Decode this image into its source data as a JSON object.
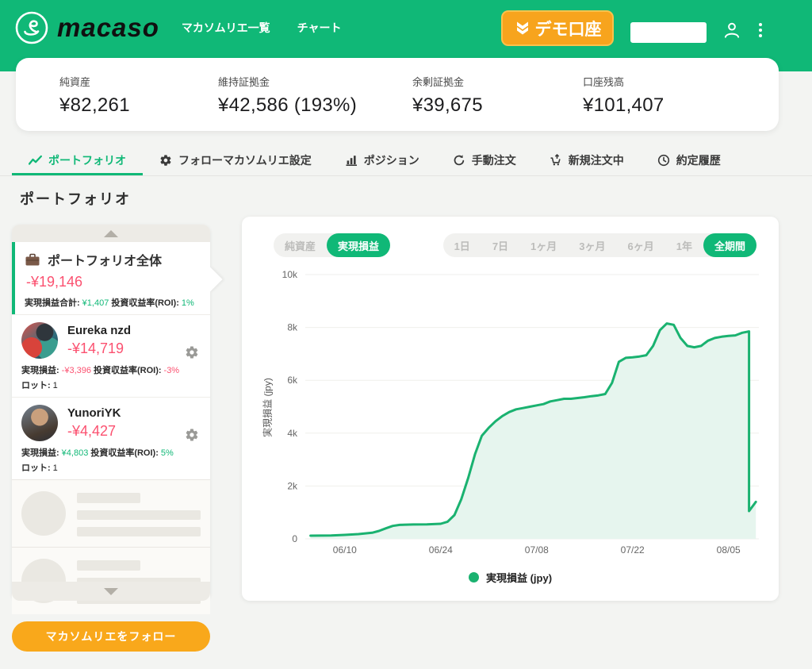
{
  "header": {
    "brand": "macaso",
    "nav": [
      {
        "label": "マカソムリエ一覧"
      },
      {
        "label": "チャート"
      }
    ],
    "demo_badge": "デモ口座"
  },
  "account_stats": [
    {
      "label": "純資産",
      "value": "¥82,261"
    },
    {
      "label": "維持証拠金",
      "value": "¥42,586 (193%)"
    },
    {
      "label": "余剰証拠金",
      "value": "¥39,675"
    },
    {
      "label": "口座残高",
      "value": "¥101,407"
    }
  ],
  "tabs": [
    {
      "label": "ポートフォリオ",
      "icon": "line-chart-icon",
      "active": true
    },
    {
      "label": "フォローマカソムリエ設定",
      "icon": "gear-icon",
      "active": false
    },
    {
      "label": "ポジション",
      "icon": "bar-chart-icon",
      "active": false
    },
    {
      "label": "手動注文",
      "icon": "refresh-icon",
      "active": false
    },
    {
      "label": "新規注文中",
      "icon": "cart-icon",
      "active": false
    },
    {
      "label": "約定履歴",
      "icon": "clock-icon",
      "active": false
    }
  ],
  "page_title": "ポートフォリオ",
  "portfolio_panel": {
    "summary": {
      "title": "ポートフォリオ全体",
      "total": "-¥19,146",
      "stat1_label": "実現損益合計:",
      "stat1_value": "¥1,407",
      "stat2_label": "投資収益率(ROI):",
      "stat2_value": "1%"
    },
    "items": [
      {
        "name": "Eureka nzd",
        "total": "-¥14,719",
        "stat1_label": "実現損益:",
        "stat1_value": "-¥3,396",
        "stat2_label": "投資収益率(ROI):",
        "stat2_value": "-3%",
        "stat3_label": "ロット:",
        "stat3_value": "1"
      },
      {
        "name": "YunoriYK",
        "total": "-¥4,427",
        "stat1_label": "実現損益:",
        "stat1_value": "¥4,803",
        "stat2_label": "投資収益率(ROI):",
        "stat2_value": "5%",
        "stat3_label": "ロット:",
        "stat3_value": "1"
      }
    ],
    "follow_button": "マカソムリエをフォロー"
  },
  "chart_card": {
    "metric_toggle": [
      {
        "label": "純資産",
        "active": false
      },
      {
        "label": "実現損益",
        "active": true
      }
    ],
    "range_toggle": [
      {
        "label": "1日",
        "active": false
      },
      {
        "label": "7日",
        "active": false
      },
      {
        "label": "1ヶ月",
        "active": false
      },
      {
        "label": "3ヶ月",
        "active": false
      },
      {
        "label": "6ヶ月",
        "active": false
      },
      {
        "label": "1年",
        "active": false
      },
      {
        "label": "全期間",
        "active": true
      }
    ]
  },
  "chart_data": {
    "type": "area",
    "title": "",
    "ylabel": "実現損益 (jpy)",
    "legend": "実現損益 (jpy)",
    "ylim": [
      0,
      10000
    ],
    "yticks": [
      "0",
      "2k",
      "4k",
      "6k",
      "8k",
      "10k"
    ],
    "xticks": [
      "06/10",
      "06/24",
      "07/08",
      "07/22",
      "08/05"
    ],
    "grid": true,
    "legend_position": "bottom",
    "line_color": "#1ab270",
    "fill_color": "#e6f5ee",
    "points": [
      [
        "06/05",
        120
      ],
      [
        "06/08",
        130
      ],
      [
        "06/10",
        150
      ],
      [
        "06/12",
        180
      ],
      [
        "06/14",
        230
      ],
      [
        "06/15",
        300
      ],
      [
        "06/16",
        400
      ],
      [
        "06/17",
        490
      ],
      [
        "06/18",
        530
      ],
      [
        "06/20",
        545
      ],
      [
        "06/22",
        550
      ],
      [
        "06/24",
        570
      ],
      [
        "06/25",
        650
      ],
      [
        "06/26",
        900
      ],
      [
        "06/27",
        1500
      ],
      [
        "06/28",
        2300
      ],
      [
        "06/29",
        3200
      ],
      [
        "06/30",
        3900
      ],
      [
        "07/01",
        4200
      ],
      [
        "07/02",
        4450
      ],
      [
        "07/03",
        4650
      ],
      [
        "07/04",
        4800
      ],
      [
        "07/05",
        4900
      ],
      [
        "07/06",
        4950
      ],
      [
        "07/07",
        5000
      ],
      [
        "07/08",
        5050
      ],
      [
        "07/09",
        5100
      ],
      [
        "07/10",
        5200
      ],
      [
        "07/11",
        5250
      ],
      [
        "07/12",
        5300
      ],
      [
        "07/13",
        5300
      ],
      [
        "07/14",
        5330
      ],
      [
        "07/15",
        5360
      ],
      [
        "07/16",
        5400
      ],
      [
        "07/17",
        5430
      ],
      [
        "07/18",
        5480
      ],
      [
        "07/19",
        5900
      ],
      [
        "07/20",
        6700
      ],
      [
        "07/21",
        6850
      ],
      [
        "07/22",
        6870
      ],
      [
        "07/23",
        6900
      ],
      [
        "07/24",
        6950
      ],
      [
        "07/25",
        7300
      ],
      [
        "07/26",
        7900
      ],
      [
        "07/27",
        8150
      ],
      [
        "07/28",
        8100
      ],
      [
        "07/29",
        7600
      ],
      [
        "07/30",
        7300
      ],
      [
        "07/31",
        7250
      ],
      [
        "08/01",
        7300
      ],
      [
        "08/02",
        7500
      ],
      [
        "08/03",
        7600
      ],
      [
        "08/04",
        7650
      ],
      [
        "08/05",
        7680
      ],
      [
        "08/06",
        7700
      ],
      [
        "08/07",
        7800
      ],
      [
        "08/08",
        7850
      ],
      [
        "08/08",
        1150
      ],
      [
        "08/08",
        1050
      ],
      [
        "08/09",
        1400
      ]
    ]
  },
  "colors": {
    "brand_green": "#10b877",
    "amber": "#f7a41d",
    "negative_red": "#fb5170",
    "positive_green": "#10b877",
    "chart_line": "#1ab270",
    "chart_fill": "#e6f5ee"
  }
}
